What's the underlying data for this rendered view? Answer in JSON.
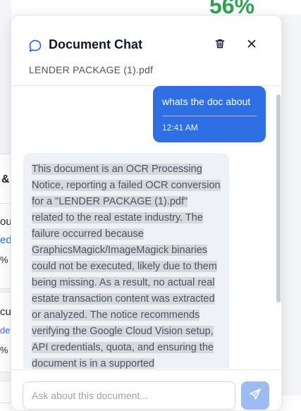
{
  "background": {
    "percent_top": "56%",
    "fragments": [
      "&",
      "ou",
      "ed",
      "%",
      "cu",
      "de",
      "%"
    ]
  },
  "chat": {
    "title": "Document Chat",
    "file_name": "LENDER PACKAGE (1).pdf",
    "icons": {
      "chat": "chat-bubble-icon",
      "delete": "trash-icon",
      "close": "close-icon",
      "send": "send-icon"
    },
    "messages": [
      {
        "role": "user",
        "text": "whats the doc about",
        "time": "12:41 AM"
      },
      {
        "role": "assistant",
        "text": "This document is an OCR Processing Notice, reporting a failed OCR conversion for a \"LENDER PACKAGE (1).pdf\" related to the real estate industry. The failure occurred because GraphicsMagick/ImageMagick binaries could not be executed, likely due to them being missing. As a result, no actual real estate transaction content was extracted or analyzed. The notice recommends verifying the Google Cloud Vision setup, API credentials, quota, and ensuring the document is in a supported"
      }
    ],
    "input_placeholder": "Ask about this document..."
  },
  "colors": {
    "accent": "#2f6fe4",
    "send_disabled": "#9ebcf4",
    "percent_green": "#2ea44f"
  }
}
